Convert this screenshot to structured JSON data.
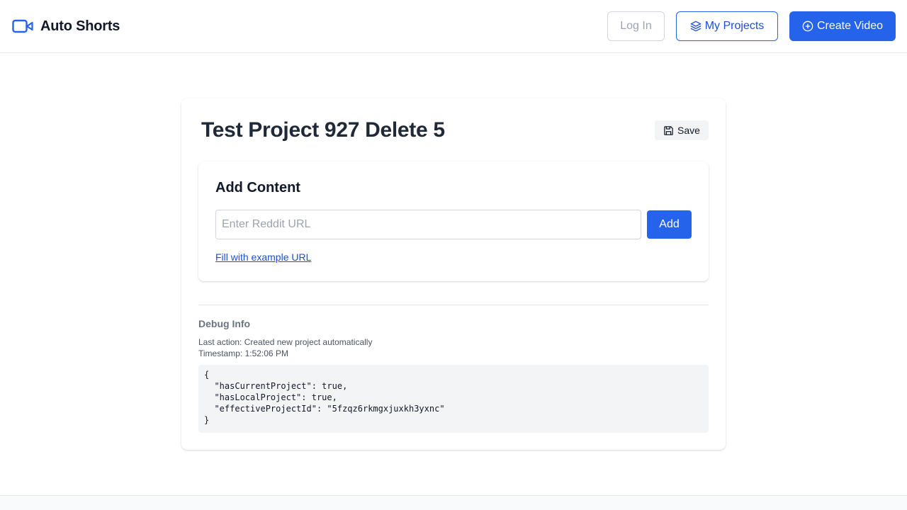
{
  "header": {
    "brand": "Auto Shorts",
    "login_label": "Log In",
    "projects_label": "My Projects",
    "create_label": "Create Video"
  },
  "project": {
    "title": "Test Project 927 Delete 5",
    "save_label": "Save"
  },
  "add_content": {
    "heading": "Add Content",
    "url_value": "",
    "url_placeholder": "Enter Reddit URL",
    "add_label": "Add",
    "example_link": "Fill with example URL"
  },
  "debug": {
    "heading": "Debug Info",
    "last_action": "Last action: Created new project automatically",
    "timestamp": "Timestamp: 1:52:06 PM",
    "json": "{\n  \"hasCurrentProject\": true,\n  \"hasLocalProject\": true,\n  \"effectiveProjectId\": \"5fzqz6rkmgxjuxkh3yxnc\"\n}"
  },
  "colors": {
    "accent": "#2563eb",
    "text_dark": "#111827",
    "muted": "#6b7280",
    "border": "#d1d5db"
  },
  "icons": {
    "brand": "video-camera-icon",
    "projects": "layers-icon",
    "create": "plus-circle-icon",
    "save": "floppy-disk-icon"
  }
}
